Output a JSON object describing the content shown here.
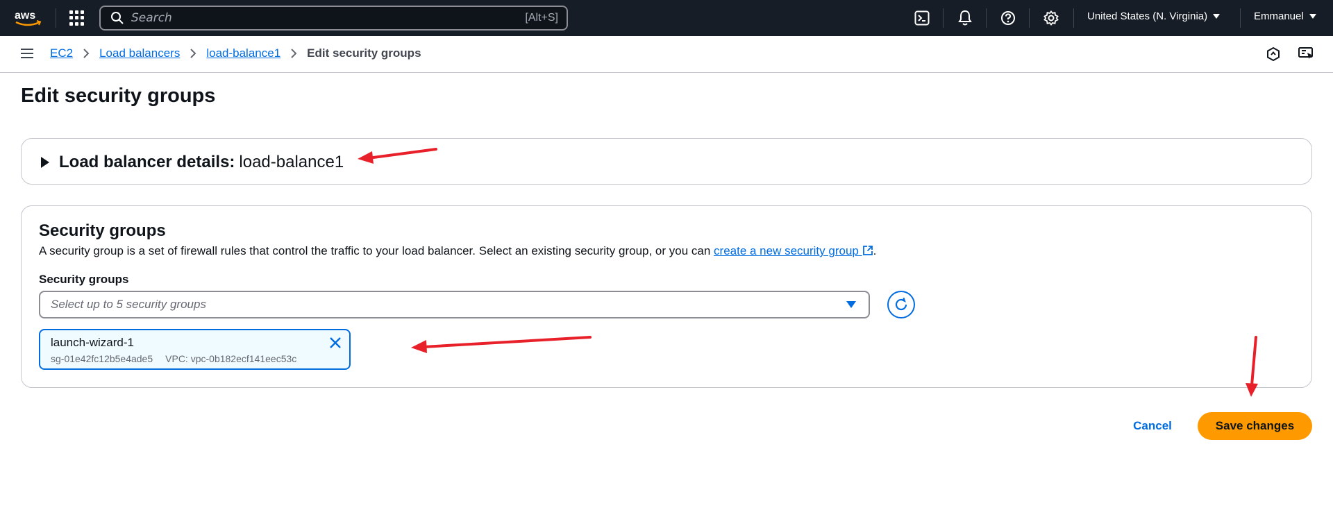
{
  "topnav": {
    "logo": "aws",
    "search_placeholder": "Search",
    "search_shortcut": "[Alt+S]",
    "icons": [
      "cloudshell-icon",
      "notifications-icon",
      "help-icon",
      "settings-icon"
    ],
    "region": "United States (N. Virginia)",
    "user": "Emmanuel"
  },
  "breadcrumbs": {
    "items": [
      "EC2",
      "Load balancers",
      "load-balance1"
    ],
    "current": "Edit security groups"
  },
  "page": {
    "title": "Edit security groups"
  },
  "details": {
    "label": "Load balancer details:",
    "value": "load-balance1"
  },
  "security_groups": {
    "heading": "Security groups",
    "description_prefix": "A security group is a set of firewall rules that control the traffic to your load balancer. Select an existing security group, or you can ",
    "description_link": "create a new security group",
    "description_suffix": ".",
    "field_label": "Security groups",
    "select_placeholder": "Select up to 5 security groups",
    "selected": [
      {
        "name": "launch-wizard-1",
        "id": "sg-01e42fc12b5e4ade5",
        "vpc": "VPC: vpc-0b182ecf141eec53c"
      }
    ]
  },
  "actions": {
    "cancel_label": "Cancel",
    "save_label": "Save changes"
  },
  "colors": {
    "nav_bg": "#161d26",
    "link": "#006ce0",
    "primary_button": "#ff9900",
    "annotation_arrow": "#e8202a"
  }
}
